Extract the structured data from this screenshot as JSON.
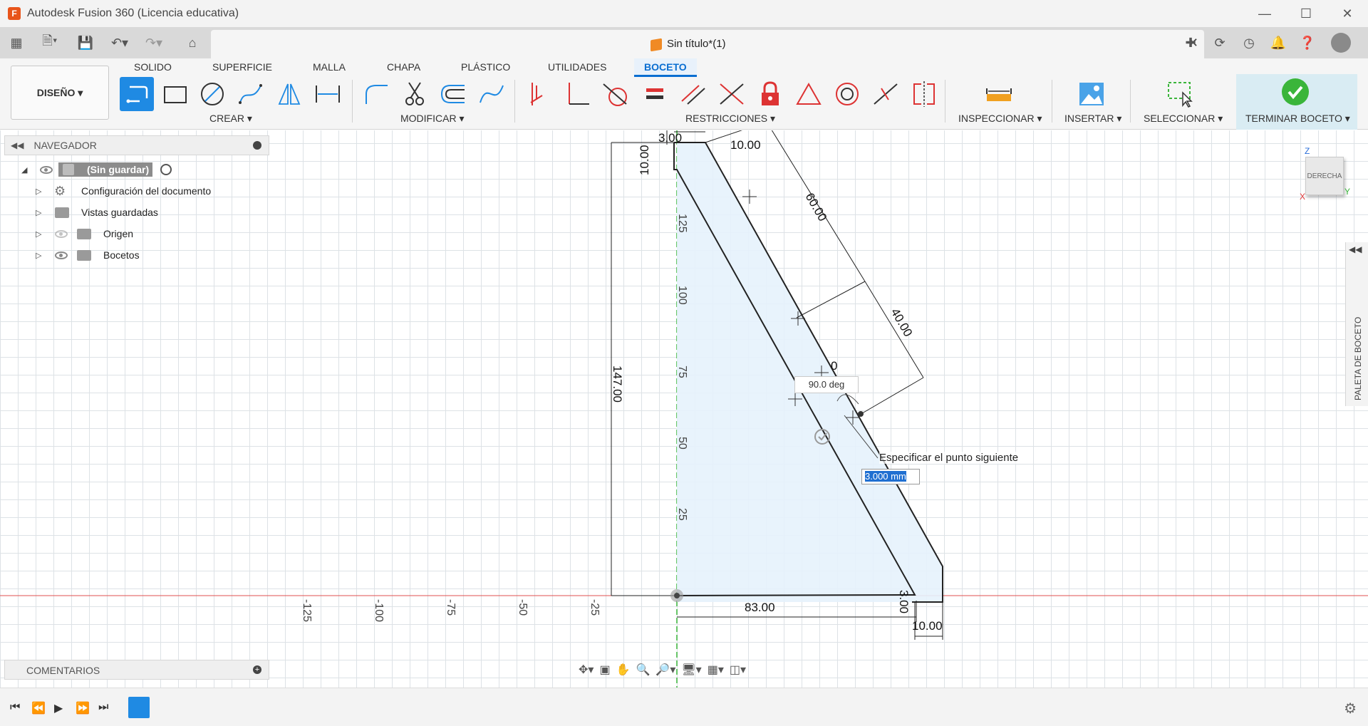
{
  "window": {
    "title": "Autodesk Fusion 360 (Licencia educativa)",
    "icon_letter": "F"
  },
  "document_tab": {
    "title": "Sin título*(1)"
  },
  "ribbon": {
    "workspace": "DISEÑO ▾",
    "tabs": [
      "SOLIDO",
      "SUPERFICIE",
      "MALLA",
      "CHAPA",
      "PLÁSTICO",
      "UTILIDADES",
      "BOCETO"
    ],
    "active_tab": "BOCETO",
    "groups": {
      "crear": "CREAR ▾",
      "modificar": "MODIFICAR ▾",
      "restricciones": "RESTRICCIONES ▾",
      "inspeccionar": "INSPECCIONAR ▾",
      "insertar": "INSERTAR ▾",
      "seleccionar": "SELECCIONAR ▾",
      "terminar": "TERMINAR BOCETO ▾"
    }
  },
  "navigator": {
    "title": "NAVEGADOR",
    "root": "(Sin guardar)",
    "items": [
      "Configuración del documento",
      "Vistas guardadas",
      "Origen",
      "Bocetos"
    ]
  },
  "comments": {
    "title": "COMENTARIOS"
  },
  "viewcube": {
    "face": "DERECHA",
    "z": "Z",
    "x": "X",
    "y": "Y"
  },
  "palette": {
    "label": "PALETA DE BOCETO"
  },
  "sketch": {
    "dimensions": {
      "top_width": "3.00",
      "top_offset": "10.00",
      "top_height": "10.00",
      "slant_upper": "60.00",
      "slant_lower": "40.00",
      "total_height": "147.00",
      "base_length": "83.00",
      "base_thickness": "3.00",
      "base_end": "10.00",
      "partial": "0"
    },
    "axis_labels_h": [
      "-125",
      "-100",
      "-75",
      "-50",
      "-25"
    ],
    "axis_labels_v": [
      "125",
      "100",
      "75",
      "50",
      "25"
    ],
    "angle": "90.0 deg",
    "prompt": "Especificar el punto siguiente",
    "length_value": "3.000 mm"
  },
  "colors": {
    "accent": "#1f8ae3",
    "x_axis": "#e05050",
    "y_axis": "#3ab53a",
    "finish": "#3ab53a"
  }
}
